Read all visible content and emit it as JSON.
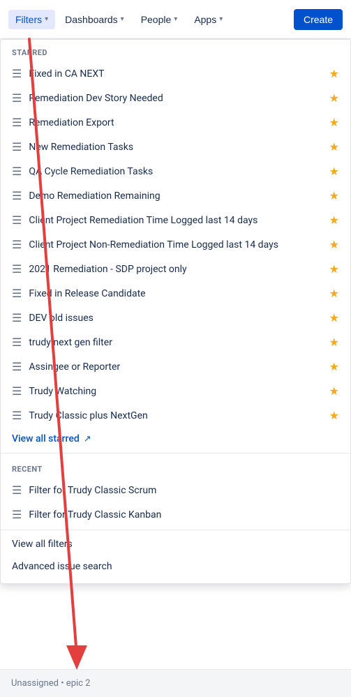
{
  "navbar": {
    "filters_label": "Filters",
    "dashboards_label": "Dashboards",
    "people_label": "People",
    "apps_label": "Apps",
    "create_label": "Create"
  },
  "dropdown": {
    "starred_section_label": "STARRED",
    "recent_section_label": "RECENT",
    "starred_items": [
      {
        "label": "Fixed in CA NEXT"
      },
      {
        "label": "Remediation Dev Story Needed"
      },
      {
        "label": "Remediation Export"
      },
      {
        "label": "New Remediation Tasks"
      },
      {
        "label": "QA Cycle Remediation Tasks"
      },
      {
        "label": "Demo Remediation Remaining"
      },
      {
        "label": "Client Project Remediation Time Logged last 14 days"
      },
      {
        "label": "Client Project Non-Remediation Time Logged last 14 days"
      },
      {
        "label": "2021 Remediation - SDP project only"
      },
      {
        "label": "Fixed in Release Candidate"
      },
      {
        "label": "DEV old issues"
      },
      {
        "label": "trudy next gen filter"
      },
      {
        "label": "Assingee or Reporter"
      },
      {
        "label": "Trudy Watching"
      },
      {
        "label": "Trudy Classic plus NextGen"
      }
    ],
    "view_all_starred_label": "View all starred",
    "recent_items": [
      {
        "label": "Filter for Trudy Classic Scrum"
      },
      {
        "label": "Filter for Trudy Classic Kanban"
      }
    ],
    "view_all_filters_label": "View all filters",
    "advanced_search_label": "Advanced issue search"
  },
  "bottom_bar": {
    "text": "Unassigned   •   epic 2"
  }
}
